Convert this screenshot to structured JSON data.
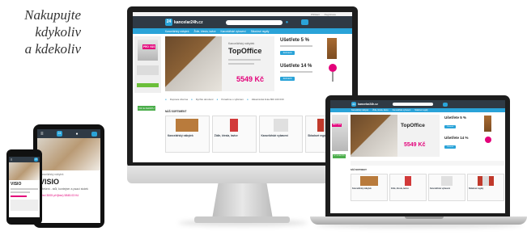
{
  "slogan": {
    "line1": "Nakupujte",
    "line2": "kdykoliv",
    "line3": "a kdekoliv"
  },
  "site": {
    "logo_text": "kancelar24h.cz",
    "logo_tagline": "",
    "top_links": [
      "Přihlásit",
      "Registrace"
    ],
    "nav": [
      "Kancelářský nábytek",
      "Židle, křesla, lavice",
      "Kancelářské vybavení",
      "Skladové regály"
    ],
    "hero": {
      "label": "Kancelářský nábytek",
      "title": "TopOffice",
      "price": "5549 Kč"
    },
    "sales": [
      {
        "title": "Ušetřete 5 %",
        "button": "Zobrazit"
      },
      {
        "title": "Ušetřete 14 %",
        "button": "Zobrazit"
      }
    ],
    "left_promo": {
      "badge": "PRO VÁS",
      "button": "DO E-SHOPU"
    },
    "features": [
      "Doprava zdarma",
      "Rychlé doručení",
      "Poradíme s výběrem",
      "Zákaznická linka 800 100 030"
    ],
    "section_title": "NÁŠ SORTIMENT",
    "categories": [
      {
        "title": "Kancelářský nábytek",
        "color": "#b97b3c"
      },
      {
        "title": "Židle, křesla, lavice",
        "color": "#d23a3a"
      },
      {
        "title": "Kancelářské vybavení",
        "color": "#8a8a8a"
      },
      {
        "title": "Skladové regály",
        "color": "#c0392b"
      }
    ]
  },
  "tablet": {
    "breadcrumb": "Kancelářský nábytek",
    "title": "VISIO",
    "description": "2 řešení - stůl, kontejner a psací stolek",
    "price": "Před 3005 pH(bez) 5845.03 Kč"
  },
  "colors": {
    "header": "#2f3a45",
    "accent": "#2aa3d8",
    "price": "#e3007a",
    "green": "#4cae4c"
  }
}
